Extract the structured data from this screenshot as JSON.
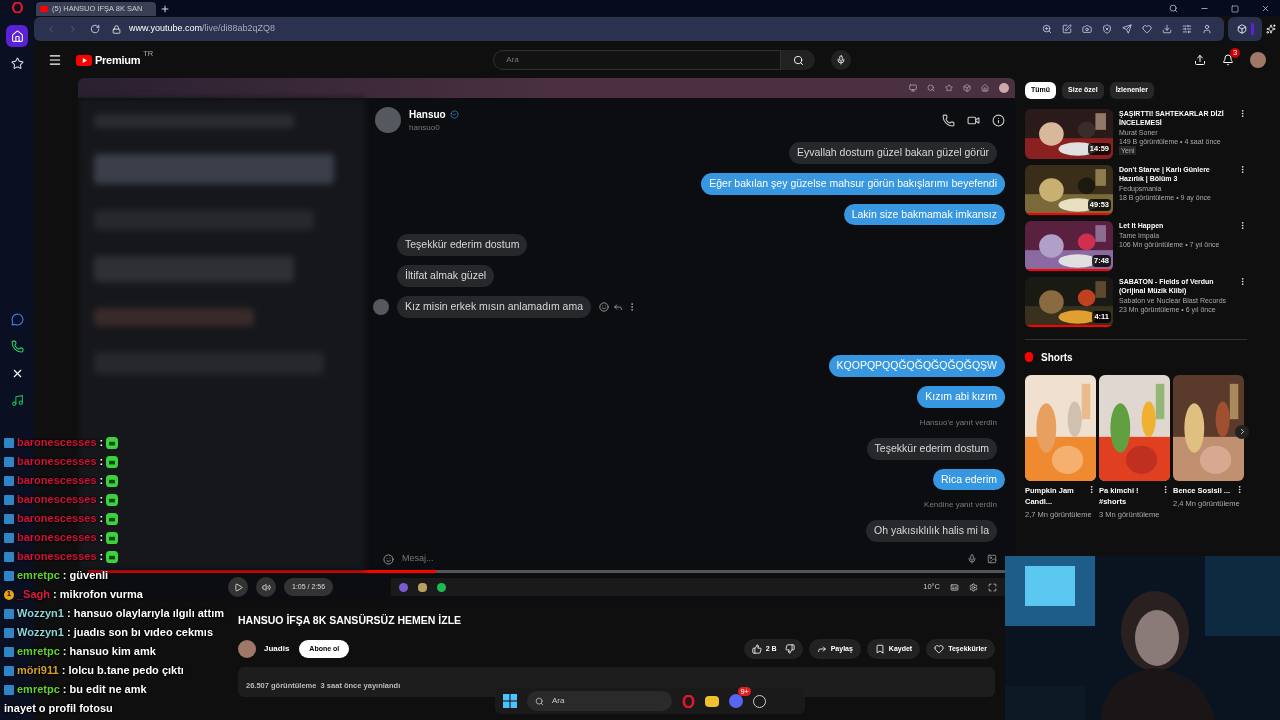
{
  "browser": {
    "tab_title": "(5) HANSUO İFŞA 8K SAN",
    "url_host": "www.youtube.com",
    "url_path": "/live/di88ab2qZQ8"
  },
  "opera_sidebar": [
    {
      "kind": "home",
      "selected": true
    },
    {
      "kind": "star",
      "selected": false
    },
    {
      "kind": "messenger",
      "selected": false
    },
    {
      "kind": "whatsapp",
      "selected": false
    },
    {
      "kind": "x",
      "selected": false
    },
    {
      "kind": "spotify",
      "selected": false
    }
  ],
  "youtube": {
    "logo": "Premium",
    "region": "TR",
    "search_placeholder": "Ara",
    "notification_count": "3"
  },
  "dm": {
    "name": "Hansuo",
    "handle": "hansuo0",
    "input_placeholder": "Mesaj...",
    "message_groups": [
      [
        {
          "kind": "quote",
          "text": "Eyvallah dostum güzel bakan güzel görür"
        },
        {
          "kind": "sent",
          "text": "Eğer bakılan şey güzelse mahsur görün bakışlarımı beyefendi"
        },
        {
          "kind": "sent",
          "text": "Lakin size bakmamak imkansız"
        },
        {
          "kind": "received",
          "text": "Teşekkür ederim dostum",
          "hovered": false
        },
        {
          "kind": "received",
          "text": "İltifat almak güzel",
          "hovered": false
        },
        {
          "kind": "received",
          "text": "Kız misin erkek mısın anlamadım ama",
          "hovered": true
        }
      ],
      [
        {
          "kind": "sent",
          "text": "KQOPQPQQĞQĞQĞQĞQĞQŞW"
        },
        {
          "kind": "sent",
          "text": "Kızım abi kızım"
        },
        {
          "kind": "note",
          "text": "Hansuo'e yanıt verdin"
        },
        {
          "kind": "quote",
          "text": "Teşekkür ederim dostum"
        },
        {
          "kind": "sent",
          "text": "Rica ederim"
        },
        {
          "kind": "note",
          "text": "Kendine yanıt verdin"
        },
        {
          "kind": "quote",
          "text": "Oh yakısıklılık halis mi la"
        }
      ]
    ]
  },
  "player": {
    "time": "1:05 / 2:56",
    "level": 0.38,
    "weather": "10°C"
  },
  "video_info": {
    "title": "HANSUO İFŞA 8K SANSÜRSÜZ HEMEN İZLE",
    "channel": "Juadis",
    "subscribe": "Abone ol",
    "like_count": "2 B",
    "actions": [
      "Paylaş",
      "Kaydet",
      "Teşekkürler"
    ],
    "stats": "26.507 görüntüleme  3 saat önce yayınlandı"
  },
  "chips": [
    {
      "label": "Tümü",
      "selected": true
    },
    {
      "label": "Size özel",
      "selected": false
    },
    {
      "label": "İzlenenler",
      "selected": false
    }
  ],
  "recommended": [
    {
      "title": "ŞAŞIRTTI! SAHTEKARLAR DİZİ İNCELEMESİ",
      "channels": [
        "Murat Soner"
      ],
      "stats": "149 B görüntüleme • 4 saat önce",
      "duration": "14:59",
      "badge": "Yeni"
    },
    {
      "title": "Don't Starve | Karlı Günlere Hazırlık | Bölüm 3",
      "channels": [
        "Fedupsmania"
      ],
      "stats": "18 B görüntüleme • 9 ay önce",
      "duration": "49:53",
      "level": 1
    },
    {
      "title": "Let It Happen",
      "channels": [
        "Tame Impala"
      ],
      "stats": "106 Mn görüntüleme • 7 yıl önce",
      "duration": "7:48",
      "level": 1
    },
    {
      "title": "SABATON - Fields of Verdun (Orijinal Müzik Klibi)",
      "channels": [
        "Sabaton",
        "ve Nuclear Blast Records"
      ],
      "stats": "23 Mn görüntüleme • 6 yıl önce",
      "duration": "4:11",
      "level": 1
    }
  ],
  "shorts": {
    "heading": "Shorts",
    "items": [
      {
        "title": "Pumpkin Jam Candl...",
        "views": "2,7 Mn görüntüleme"
      },
      {
        "title": "Pa kimchi ! #shorts",
        "views": "3 Mn görüntüleme"
      },
      {
        "title": "Bence Sosisli ...",
        "views": "2,4 Mn görüntüleme"
      }
    ]
  },
  "chat_separator": ":",
  "chat": [
    {
      "kind": "emote",
      "user": "baronescesses",
      "color": "#d41237"
    },
    {
      "kind": "emote",
      "user": "baronescesses",
      "color": "#d41237"
    },
    {
      "kind": "emote",
      "user": "baronescesses",
      "color": "#d41237"
    },
    {
      "kind": "emote",
      "user": "baronescesses",
      "color": "#d41237"
    },
    {
      "kind": "emote",
      "user": "baronescesses",
      "color": "#d41237"
    },
    {
      "kind": "emote",
      "user": "baronescesses",
      "color": "#d41237"
    },
    {
      "kind": "emote",
      "user": "baronescesses",
      "color": "#d41237"
    },
    {
      "kind": "text",
      "user": "emretpc",
      "color": "#63d22f",
      "text": "güvenli"
    },
    {
      "kind": "text",
      "user": "_Sagh",
      "color": "#e0193a",
      "text": "mikrofon vurma",
      "subscriber_badge": "1"
    },
    {
      "kind": "text",
      "user": "Wozzyn1",
      "color": "#8ad6d6",
      "text": "hansuo olaylarıyla ılgılı attım"
    },
    {
      "kind": "text",
      "user": "Wozzyn1",
      "color": "#8ad6d6",
      "text": "juadıs son bı vıdeo cekmıs"
    },
    {
      "kind": "text",
      "user": "emretpc",
      "color": "#63d22f",
      "text": "hansuo kim amk"
    },
    {
      "kind": "text",
      "user": "möri911",
      "color": "#d6a21e",
      "text": "lolcu b.tane pedo çıktı"
    },
    {
      "kind": "text",
      "user": "emretpc",
      "color": "#63d22f",
      "text": "bu edit ne amk"
    },
    {
      "kind": "plain",
      "text": "inayet o profil fotosu"
    }
  ],
  "taskbar": {
    "search_placeholder": "Ara",
    "discord_badge": "9+"
  }
}
